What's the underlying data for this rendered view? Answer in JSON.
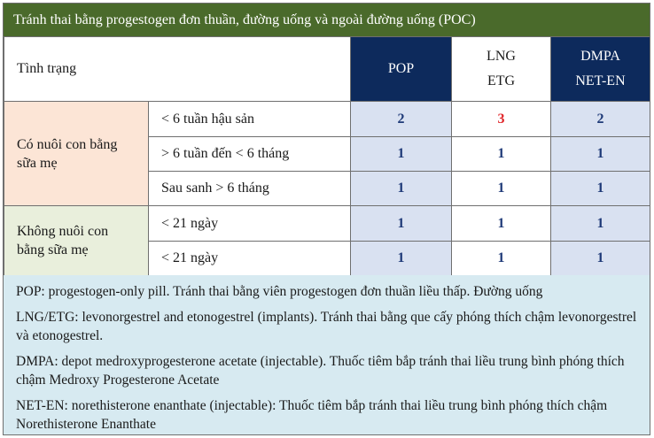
{
  "title": "Tránh thai bằng progestogen đơn thuần, đường uống và ngoài đường uống (POC)",
  "header": {
    "condition_label": "Tình trạng",
    "pop": "POP",
    "lng_line1": "LNG",
    "lng_line2": "ETG",
    "dmpa_line1": "DMPA",
    "dmpa_line2": "NET-EN"
  },
  "groups": [
    {
      "label_line1": "Có nuôi con bằng",
      "label_line2": "sữa mẹ",
      "rows": [
        {
          "label": "< 6 tuần hậu sản",
          "pop": "2",
          "lng": "3",
          "dmpa": "2"
        },
        {
          "label": "> 6 tuần đến < 6 tháng",
          "pop": "1",
          "lng": "1",
          "dmpa": "1"
        },
        {
          "label": "Sau sanh > 6 tháng",
          "pop": "1",
          "lng": "1",
          "dmpa": "1"
        }
      ]
    },
    {
      "label_line1": "Không nuôi con",
      "label_line2": "bằng sữa mẹ",
      "rows": [
        {
          "label": "< 21 ngày",
          "pop": "1",
          "lng": "1",
          "dmpa": "1"
        },
        {
          "label": "< 21 ngày",
          "pop": "1",
          "lng": "1",
          "dmpa": "1"
        }
      ]
    }
  ],
  "notes": [
    "POP: progestogen-only pill. Tránh thai bằng viên progestogen đơn thuần liều thấp. Đường uống",
    "LNG/ETG: levonorgestrel and etonogestrel (implants). Tránh thai bằng que cấy phóng thích chậm levonorgestrel và etonogestrel.",
    "DMPA: depot medroxyprogesterone acetate (injectable). Thuốc tiêm bắp tránh thai liều trung bình phóng thích chậm Medroxy Progesterone Acetate",
    "NET-EN: norethisterone enanthate (injectable): Thuốc tiêm bắp tránh thai liều trung bình phóng thích chậm Norethisterone Enanthate"
  ],
  "colors": {
    "title_bg": "#4a6a2b",
    "header_dark": "#0d2a5c",
    "value_text": "#1f3a78",
    "highlight_value": "#e0262a",
    "breastfeeding_bg": "#fce5d6",
    "non_breastfeeding_bg": "#e9efdc",
    "notes_bg": "#d7eaf1"
  }
}
